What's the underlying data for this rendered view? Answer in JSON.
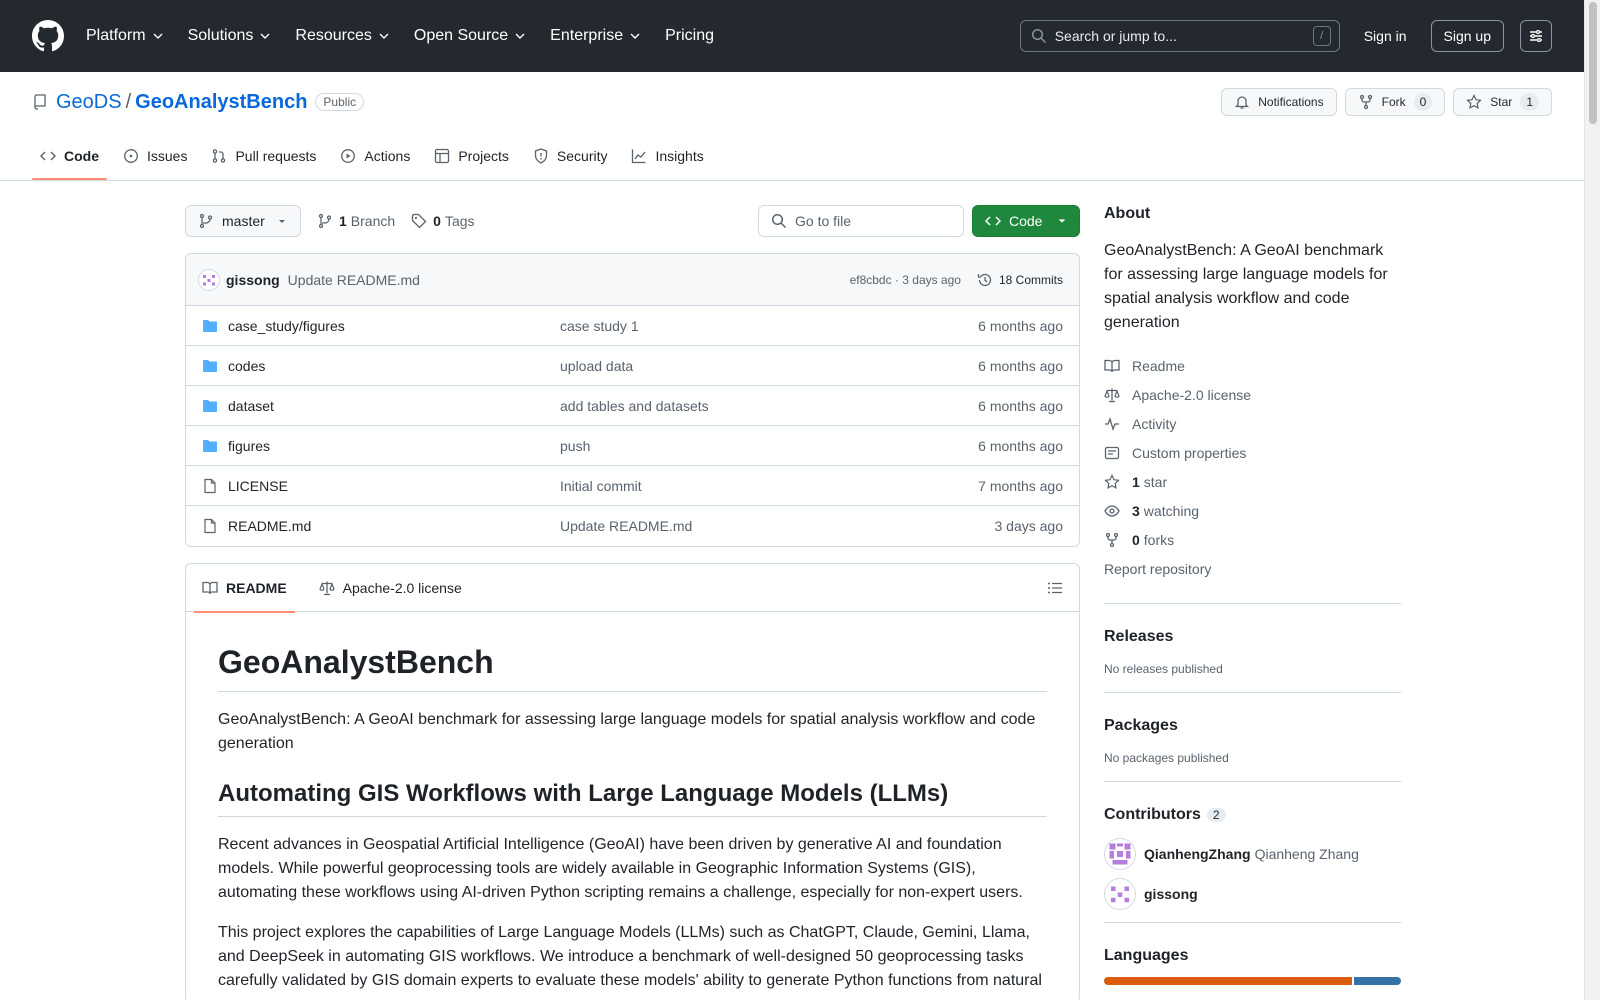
{
  "header": {
    "nav": [
      {
        "label": "Platform",
        "dropdown": true
      },
      {
        "label": "Solutions",
        "dropdown": true
      },
      {
        "label": "Resources",
        "dropdown": true
      },
      {
        "label": "Open Source",
        "dropdown": true
      },
      {
        "label": "Enterprise",
        "dropdown": true
      },
      {
        "label": "Pricing",
        "dropdown": false
      }
    ],
    "search_placeholder": "Search or jump to...",
    "search_shortcut": "/",
    "sign_in": "Sign in",
    "sign_up": "Sign up"
  },
  "repo": {
    "owner": "GeoDS",
    "separator": "/",
    "name": "GeoAnalystBench",
    "visibility": "Public",
    "notifications_label": "Notifications",
    "fork_label": "Fork",
    "fork_count": "0",
    "star_label": "Star",
    "star_count": "1",
    "tabs": [
      {
        "label": "Code",
        "icon": "code-icon",
        "active": true
      },
      {
        "label": "Issues",
        "icon": "issue-icon"
      },
      {
        "label": "Pull requests",
        "icon": "pull-request-icon"
      },
      {
        "label": "Actions",
        "icon": "play-icon"
      },
      {
        "label": "Projects",
        "icon": "table-icon"
      },
      {
        "label": "Security",
        "icon": "shield-icon"
      },
      {
        "label": "Insights",
        "icon": "graph-icon"
      }
    ]
  },
  "file_nav": {
    "branch": "master",
    "branch_count": "1",
    "branch_label": "Branch",
    "tag_count": "0",
    "tag_label": "Tags",
    "goto_placeholder": "Go to file",
    "code_button": "Code"
  },
  "latest_commit": {
    "author": "gissong",
    "message": "Update README.md",
    "meta": "ef8cbdc · 3 days ago",
    "commits_label": "18 Commits"
  },
  "files": [
    {
      "type": "dir",
      "name": "case_study/figures",
      "message": "case study 1",
      "date": "6 months ago"
    },
    {
      "type": "dir",
      "name": "codes",
      "message": "upload data",
      "date": "6 months ago"
    },
    {
      "type": "dir",
      "name": "dataset",
      "message": "add tables and datasets",
      "date": "6 months ago"
    },
    {
      "type": "dir",
      "name": "figures",
      "message": "push",
      "date": "6 months ago"
    },
    {
      "type": "file",
      "name": "LICENSE",
      "message": "Initial commit",
      "date": "7 months ago"
    },
    {
      "type": "file",
      "name": "README.md",
      "message": "Update README.md",
      "date": "3 days ago"
    }
  ],
  "readme": {
    "tab_readme": "README",
    "tab_license": "Apache-2.0 license",
    "title": "GeoAnalystBench",
    "intro": "GeoAnalystBench: A GeoAI benchmark for assessing large language models for spatial analysis workflow and code generation",
    "h2": "Automating GIS Workflows with Large Language Models (LLMs)",
    "p1": "Recent advances in Geospatial Artificial Intelligence (GeoAI) have been driven by generative AI and foundation models. While powerful geoprocessing tools are widely available in Geographic Information Systems (GIS), automating these workflows using AI-driven Python scripting remains a challenge, especially for non-expert users.",
    "p2": "This project explores the capabilities of Large Language Models (LLMs) such as ChatGPT, Claude, Gemini, Llama, and DeepSeek in automating GIS workflows. We introduce a benchmark of well-designed 50 geoprocessing tasks carefully validated by GIS domain experts to evaluate these models' ability to generate Python functions from natural"
  },
  "about": {
    "title": "About",
    "description": "GeoAnalystBench: A GeoAI benchmark for assessing large language models for spatial analysis workflow and code generation",
    "links": [
      {
        "icon": "book-icon",
        "label": "Readme"
      },
      {
        "icon": "law-icon",
        "label": "Apache-2.0 license"
      },
      {
        "icon": "pulse-icon",
        "label": "Activity"
      },
      {
        "icon": "note-icon",
        "label": "Custom properties"
      },
      {
        "icon": "star-icon",
        "count": "1",
        "label": "star"
      },
      {
        "icon": "eye-icon",
        "count": "3",
        "label": "watching"
      },
      {
        "icon": "fork-icon",
        "count": "0",
        "label": "forks"
      }
    ],
    "report": "Report repository"
  },
  "releases": {
    "title": "Releases",
    "note": "No releases published"
  },
  "packages": {
    "title": "Packages",
    "note": "No packages published"
  },
  "contributors": {
    "title": "Contributors",
    "count": "2",
    "list": [
      {
        "login": "QianhengZhang",
        "name": "Qianheng Zhang"
      },
      {
        "login": "gissong",
        "name": ""
      }
    ]
  },
  "languages": {
    "title": "Languages",
    "colors": [
      "#DA5B0B",
      "#3572A5"
    ],
    "shares": [
      0.84,
      0.16
    ]
  }
}
